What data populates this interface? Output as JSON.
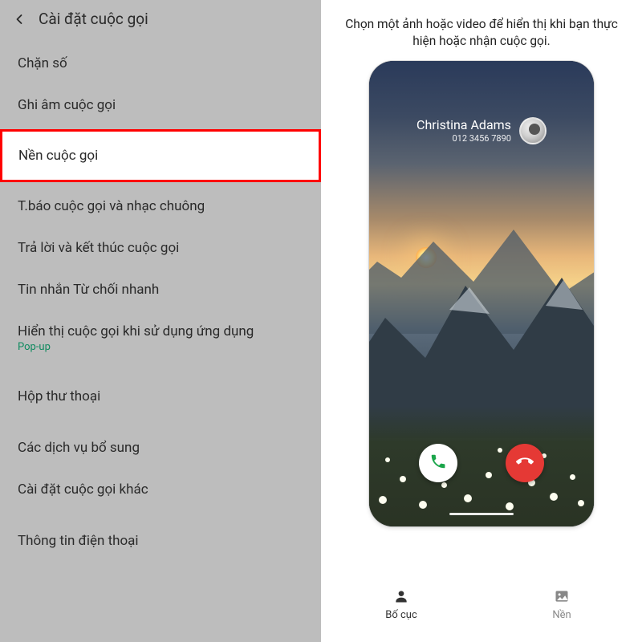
{
  "left": {
    "title": "Cài đặt cuộc gọi",
    "items": [
      {
        "label": "Chặn số"
      },
      {
        "label": "Ghi âm cuộc gọi"
      },
      {
        "label": "Nền cuộc gọi",
        "selected": true
      },
      {
        "label": "T.báo cuộc gọi và nhạc chuông"
      },
      {
        "label": "Trả lời và kết thúc cuộc gọi"
      },
      {
        "label": "Tin nhắn Từ chối nhanh"
      },
      {
        "label": "Hiển thị cuộc gọi khi sử dụng ứng dụng",
        "sub": "Pop-up"
      },
      {
        "label": "Hộp thư thoại"
      },
      {
        "label": "Các dịch vụ bổ sung"
      },
      {
        "label": "Cài đặt cuộc gọi khác"
      },
      {
        "label": "Thông tin điện thoại"
      }
    ]
  },
  "right": {
    "instruction": "Chọn một ảnh hoặc video để hiển thị khi bạn thực hiện hoặc nhận cuộc gọi.",
    "caller_name": "Christina Adams",
    "caller_number": "012 3456 7890",
    "nav": {
      "layout": "Bố cục",
      "background": "Nền"
    }
  }
}
